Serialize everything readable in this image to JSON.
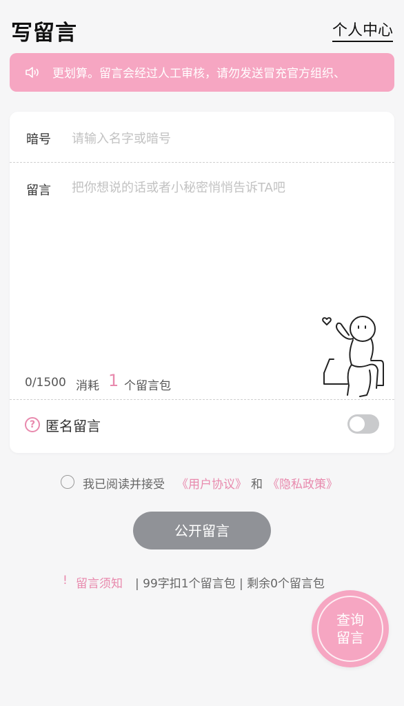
{
  "header": {
    "title": "写留言",
    "user_center": "个人中心"
  },
  "notice": {
    "icon": "speaker-icon",
    "text": "更划算。留言会经过人工审核，请勿发送冒充官方组织、"
  },
  "form": {
    "name_label": "暗号",
    "name_placeholder": "请输入名字或暗号",
    "message_label": "留言",
    "message_placeholder": "把你想说的话或者小秘密悄悄告诉TA吧",
    "counter": "0/1500",
    "consume_prefix": "消耗",
    "consume_count": "1",
    "consume_suffix": "个留言包",
    "anonymous_label": "匿名留言",
    "anonymous_enabled": false
  },
  "agreement": {
    "checked": false,
    "text": "我已阅读并接受",
    "user_agreement": "《用户协议》",
    "and": "和",
    "privacy_policy": "《隐私政策》"
  },
  "submit_label": "公开留言",
  "rules": {
    "bang": "!",
    "link": "留言须知",
    "info": "| 99字扣1个留言包 | 剩余0个留言包"
  },
  "fab": {
    "label": "查询留言"
  },
  "colors": {
    "accent_pink": "#f6a6c2",
    "link_pink": "#e889ad",
    "button_gray": "#909297"
  }
}
